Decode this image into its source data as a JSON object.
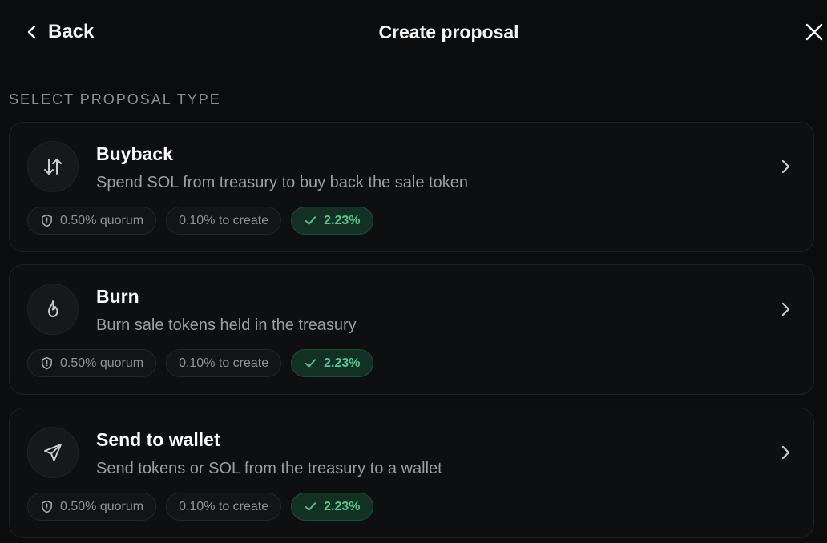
{
  "header": {
    "back_label": "Back",
    "title": "Create proposal",
    "back_icon": "chevron-left-icon",
    "close_icon": "close-icon"
  },
  "section": {
    "label": "SELECT PROPOSAL TYPE"
  },
  "proposals": [
    {
      "title": "Buyback",
      "description": "Spend SOL from treasury to buy back the sale token",
      "icon": "swap-vertical-icon",
      "quorum": "0.50% quorum",
      "create": "0.10% to create",
      "holding": "2.23%"
    },
    {
      "title": "Burn",
      "description": "Burn sale tokens held in the treasury",
      "icon": "flame-icon",
      "quorum": "0.50% quorum",
      "create": "0.10% to create",
      "holding": "2.23%"
    },
    {
      "title": "Send to wallet",
      "description": "Send tokens or SOL from the treasury to a wallet",
      "icon": "send-icon",
      "quorum": "0.50% quorum",
      "create": "0.10% to create",
      "holding": "2.23%"
    }
  ],
  "colors": {
    "background": "#0b0c0d",
    "card": "#0e0f11",
    "accent_green": "#58c58e",
    "muted_text": "#9a9ea3"
  }
}
